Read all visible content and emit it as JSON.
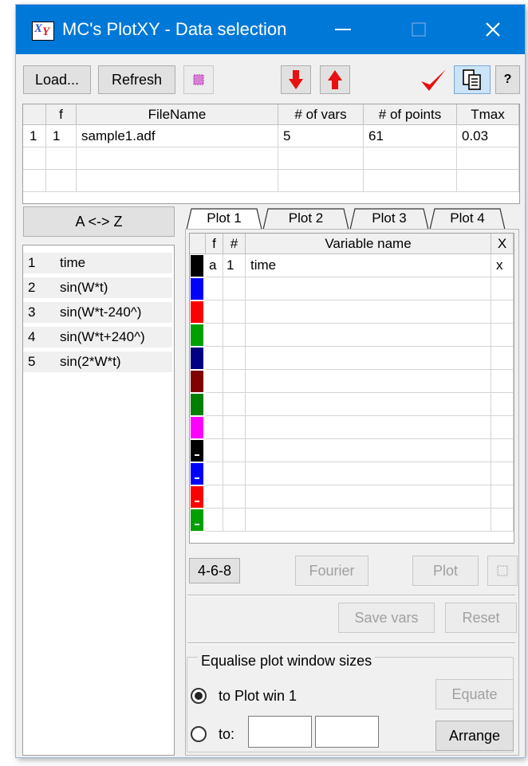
{
  "window": {
    "title": "MC's PlotXY - Data selection",
    "app_icon_text": "XY",
    "accent": "#0078d7"
  },
  "toolbar": {
    "load_label": "Load...",
    "refresh_label": "Refresh",
    "help_label": "?"
  },
  "file_table": {
    "columns": [
      "",
      "f",
      "FileName",
      "# of vars",
      "# of points",
      "Tmax"
    ],
    "rows": [
      [
        "1",
        "1",
        "sample1.adf",
        "5",
        "61",
        "0.03"
      ]
    ]
  },
  "sort_button_label": "A <-> Z",
  "variables": [
    {
      "num": "1",
      "name": "time"
    },
    {
      "num": "2",
      "name": "sin(W*t)"
    },
    {
      "num": "3",
      "name": "sin(W*t-240^)"
    },
    {
      "num": "4",
      "name": "sin(W*t+240^)"
    },
    {
      "num": "5",
      "name": "sin(2*W*t)"
    }
  ],
  "tabs": [
    "Plot 1",
    "Plot 2",
    "Plot 3",
    "Plot 4"
  ],
  "active_tab": "Plot 1",
  "plot_table": {
    "columns": [
      "",
      "f",
      "#",
      "Variable name",
      "X"
    ],
    "rows": [
      {
        "f": "a",
        "num": "1",
        "name": "time",
        "x": "x"
      }
    ],
    "row_colors": [
      "#000000",
      "#0000ff",
      "#ff0000",
      "#00a000",
      "#000080",
      "#800000",
      "#008000",
      "#ff00ff",
      "#000000",
      "#0000ff",
      "#ff0000",
      "#00a000"
    ]
  },
  "buttons": {
    "layout": "4-6-8",
    "fourier": "Fourier",
    "plot": "Plot",
    "save_vars": "Save vars",
    "reset": "Reset",
    "equate": "Equate",
    "arrange": "Arrange"
  },
  "equalise": {
    "group_label": "Equalise plot window sizes",
    "option1": "to Plot win 1",
    "option2": "to:",
    "selected": "option1"
  }
}
